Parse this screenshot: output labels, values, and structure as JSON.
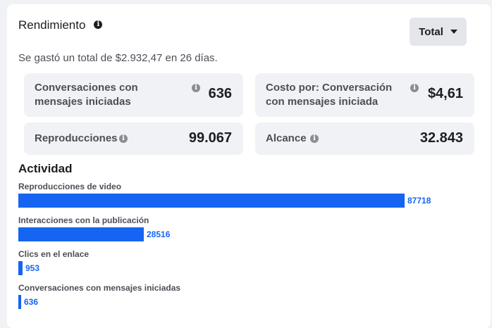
{
  "header": {
    "title": "Rendimiento",
    "dropdown_label": "Total"
  },
  "summary": {
    "spent_text": "Se gastó un total de $2.932,47 en 26 días."
  },
  "metrics": [
    {
      "label": "Conversaciones con mensajes iniciadas",
      "value": "636"
    },
    {
      "label": "Costo por: Conversación con mensajes iniciada",
      "value": "$4,61"
    },
    {
      "label": "Reproducciones",
      "value": "99.067"
    },
    {
      "label": "Alcance",
      "value": "32.843"
    }
  ],
  "activity": {
    "title": "Actividad",
    "items": [
      {
        "label": "Reproducciones de video",
        "value": 87718,
        "value_text": "87718"
      },
      {
        "label": "Interacciones con la publicación",
        "value": 28516,
        "value_text": "28516"
      },
      {
        "label": "Clics en el enlace",
        "value": 953,
        "value_text": "953"
      },
      {
        "label": "Conversaciones con mensajes iniciadas",
        "value": 636,
        "value_text": "636"
      }
    ]
  },
  "colors": {
    "accent": "#1664f2",
    "card_bg": "#ffffff",
    "metric_bg": "#f0f2f5"
  },
  "icons": {
    "info": "info-icon",
    "dropdown": "caret-down-icon"
  }
}
